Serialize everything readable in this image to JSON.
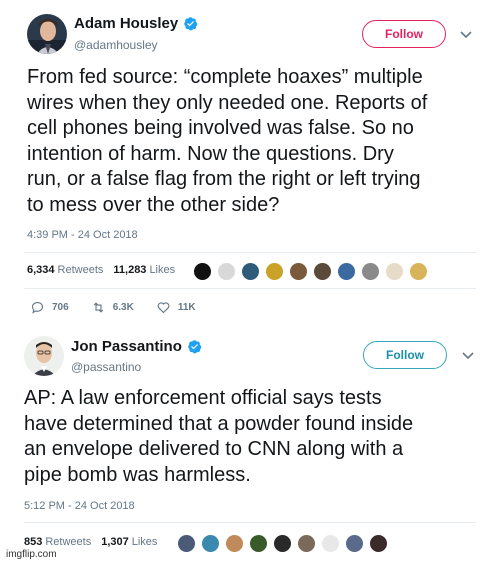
{
  "colors": {
    "brand_blue": "#1da1f2",
    "follow_red": "#e0245e",
    "follow_teal": "#3aa8b8",
    "muted": "#657786",
    "text": "#14171a"
  },
  "tweets": [
    {
      "author": {
        "name": "Adam Housley",
        "handle": "@adamhousley",
        "verified": true,
        "avatar_icon": "profile-photo-icon"
      },
      "follow_label": "Follow",
      "text_lines": [
        "From fed source: “complete hoaxes” multiple",
        "wires when they only needed one. Reports of",
        "cell phones being involved was false. So no",
        "intention of harm. Now the questions. Dry",
        "run, or a false flag from the right or left trying",
        "to mess over the other side?"
      ],
      "timestamp": "4:39 PM - 24 Oct 2018",
      "retweets_count": "6,334",
      "retweets_label": "Retweets",
      "likes_count": "11,283",
      "likes_label": "Likes",
      "likers_count": 10,
      "actions": {
        "replies": "706",
        "retweets": "6.3K",
        "likes": "11K"
      }
    },
    {
      "author": {
        "name": "Jon Passantino",
        "handle": "@passantino",
        "verified": true,
        "avatar_icon": "profile-photo-icon"
      },
      "follow_label": "Follow",
      "text_lines": [
        "AP: A law enforcement official says tests",
        "have determined that a powder found inside",
        "an envelope delivered to CNN along with a",
        "pipe bomb was harmless."
      ],
      "timestamp": "5:12 PM - 24 Oct 2018",
      "retweets_count": "853",
      "retweets_label": "Retweets",
      "likes_count": "1,307",
      "likes_label": "Likes",
      "likers_count": 9
    }
  ],
  "watermark": "imgflip.com"
}
